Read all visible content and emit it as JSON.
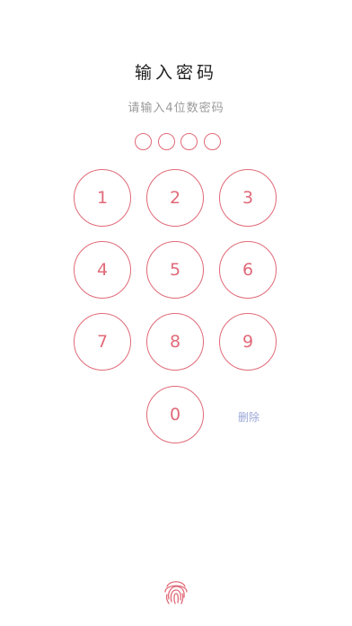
{
  "header": {
    "title": "输入密码",
    "subtitle": "请输入4位数密码"
  },
  "pin": {
    "length": 4,
    "filled": 0
  },
  "keypad": {
    "keys": [
      "1",
      "2",
      "3",
      "4",
      "5",
      "6",
      "7",
      "8",
      "9",
      "0"
    ],
    "delete_label": "删除"
  },
  "icons": {
    "fingerprint": "fingerprint-icon"
  },
  "colors": {
    "accent": "#e06a78",
    "delete_text": "#9aa6d8",
    "subtitle_text": "#9a9a9a",
    "title_text": "#222222"
  }
}
